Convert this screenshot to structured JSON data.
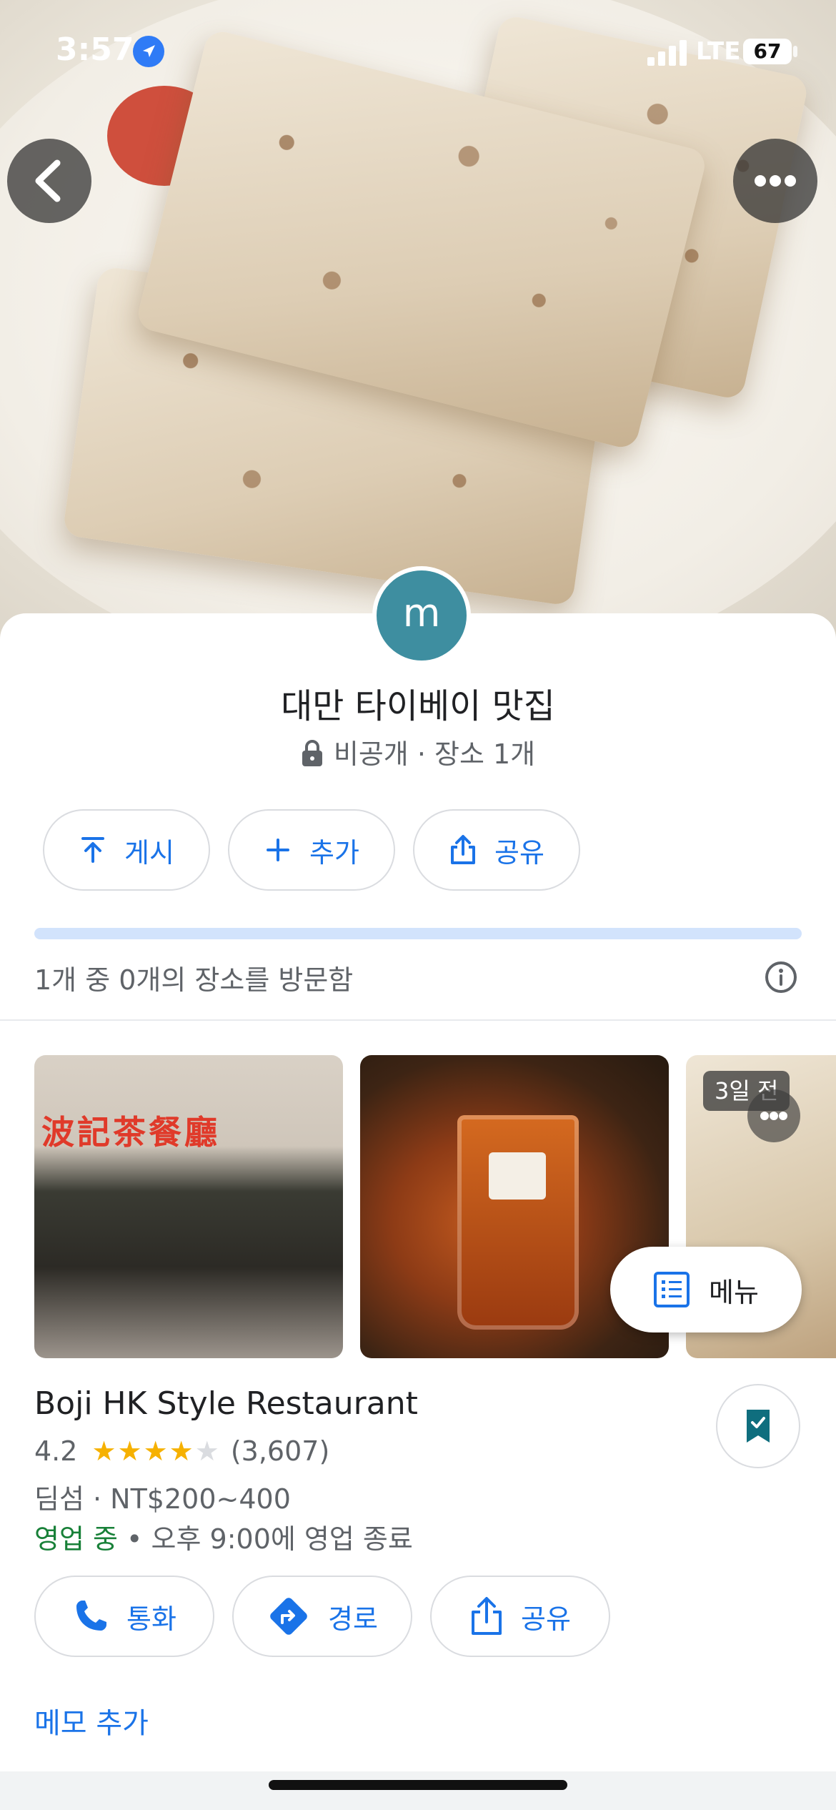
{
  "status_bar": {
    "time": "3:57",
    "network": "LTE",
    "battery": "67"
  },
  "list": {
    "avatar_letter": "m",
    "title": "대만 타이베이 맛집",
    "privacy": "비공개",
    "separator": " · ",
    "place_count": "장소 1개",
    "actions": {
      "post": "게시",
      "add": "추가",
      "share": "공유"
    },
    "visited_text": "1개 중 0개의 장소를 방문함",
    "visited_progress": 0
  },
  "place": {
    "name": "Boji HK Style Restaurant",
    "rating": "4.2",
    "stars": 4,
    "reviews": "(3,607)",
    "category": "딤섬",
    "price": "NT$200~400",
    "open_status": "영업 중",
    "dot": " • ",
    "closing": "오후 9:00에 영업 종료",
    "photos": {
      "days_ago": "3일 전",
      "sign_text": "波記茶餐廳"
    },
    "menu_label": "메뉴",
    "actions": {
      "call": "통화",
      "route": "경로",
      "share": "공유"
    },
    "add_note": "메모 추가"
  },
  "colors": {
    "accent": "#1a73e8",
    "open": "#188038",
    "avatar": "#3e8ea0",
    "star": "#f6b100"
  }
}
